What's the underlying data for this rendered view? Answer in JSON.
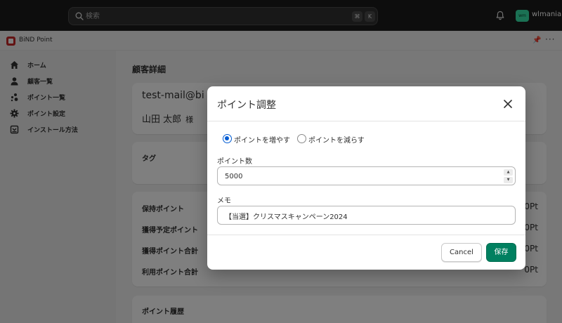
{
  "topbar": {
    "search_placeholder": "検索",
    "shortcut_keys": [
      "⌘",
      "K"
    ],
    "avatar_initials": "wm",
    "user_name": "wlmania"
  },
  "app": {
    "name": "BiND Point"
  },
  "sidebar": {
    "items": [
      {
        "label": "ホーム",
        "icon": "home-icon"
      },
      {
        "label": "顧客一覧",
        "icon": "person-icon"
      },
      {
        "label": "ポイント一覧",
        "icon": "points-icon"
      },
      {
        "label": "ポイント設定",
        "icon": "gear-icon"
      },
      {
        "label": "インストール方法",
        "icon": "install-icon"
      }
    ]
  },
  "main": {
    "title": "顧客詳細",
    "customer": {
      "email": "test-mail@bi",
      "name": "山田 太郎",
      "honorific": "様"
    },
    "tag_title": "タグ",
    "points": [
      {
        "label": "保持ポイント",
        "value": "0Pt"
      },
      {
        "label": "獲得予定ポイント",
        "value": "0Pt"
      },
      {
        "label": "獲得ポイント合計",
        "value": "0Pt"
      },
      {
        "label": "利用ポイント合計",
        "value": "0Pt"
      }
    ],
    "history_title": "ポイント履歴"
  },
  "modal": {
    "title": "ポイント調整",
    "radio_increase": "ポイントを増やす",
    "radio_decrease": "ポイントを減らす",
    "points_label": "ポイント数",
    "points_value": "5000",
    "memo_label": "メモ",
    "memo_value": "【当選】クリスマスキャンペーン2024",
    "cancel_label": "Cancel",
    "save_label": "保存"
  },
  "colors": {
    "primary_button": "#008060",
    "radio_selected": "#005bd3",
    "avatar_bg": "#36e3a8",
    "app_logo": "#c62828"
  }
}
